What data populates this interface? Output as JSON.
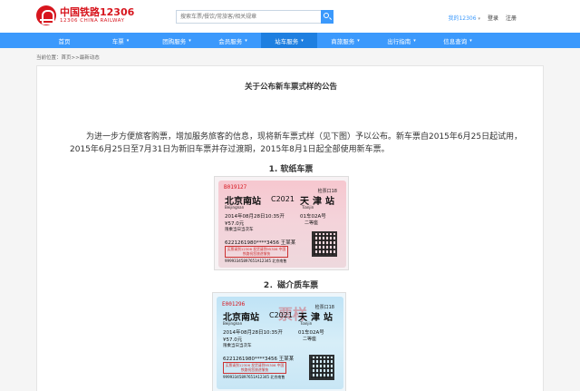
{
  "header": {
    "logo_cn": "中国铁路12306",
    "logo_en": "12306 CHINA RAILWAY",
    "search_placeholder": "搜索车票/餐饮/常旅客/相关规章",
    "my_account": "我的12306",
    "login": "登录",
    "register": "注册"
  },
  "nav": {
    "items": [
      {
        "label": "首页",
        "caret": ""
      },
      {
        "label": "车票",
        "caret": "▾"
      },
      {
        "label": "团购服务",
        "caret": "▾"
      },
      {
        "label": "会员服务",
        "caret": "▾"
      },
      {
        "label": "站车服务",
        "caret": "▾"
      },
      {
        "label": "商旅服务",
        "caret": "▾"
      },
      {
        "label": "出行指南",
        "caret": "▾"
      },
      {
        "label": "信息查询",
        "caret": "▾"
      }
    ]
  },
  "breadcrumb": "当前位置：首页>>最新动态",
  "article": {
    "title": "关于公布新车票式样的公告",
    "paragraph": "为进一步方便旅客购票，增加服务旅客的信息，现将新车票式样（见下图）予以公布。新车票自2015年6月25日起试用，2015年6月25日至7月31日为新旧车票并存过渡期，2015年8月1日起全部使用新车票。",
    "section1": "1. 软纸车票",
    "section2": "2．磁介质车票"
  },
  "tickets": [
    {
      "serial": "B019127",
      "gate": "检票口18",
      "from": "北京南站",
      "train": "C2021",
      "to": "天津站",
      "pinyin_from": "Beijingnan",
      "pinyin_to": "Tianjin",
      "date": "2014年08月28日10:35开",
      "seat": "01车02A号",
      "price": "¥57.0元",
      "seat_class": "二等座",
      "note": "限乘当日当次车",
      "id": "6221261980****3456 王某某",
      "fine": "买票请到12306 发货请到95306 中国铁路祝您旅途愉快",
      "bottom": "99993345897651A12345 北京南售"
    },
    {
      "serial": "E001296",
      "gate": "检票口18",
      "from": "北京南站",
      "train": "C2021",
      "to": "天津站",
      "pinyin_from": "Beijingnan",
      "pinyin_to": "Tianjin",
      "date": "2014年08月28日10:35开",
      "seat": "01车02A号",
      "price": "¥57.0元",
      "seat_class": "二等座",
      "note": "限乘当日当次车",
      "id": "6221261980****3456 王某某",
      "fine": "买票请到12306 发货请到95306 中国铁路祝您旅途愉快",
      "bottom": "99993345897651A12345 北京南售",
      "stamp": "票样"
    }
  ]
}
